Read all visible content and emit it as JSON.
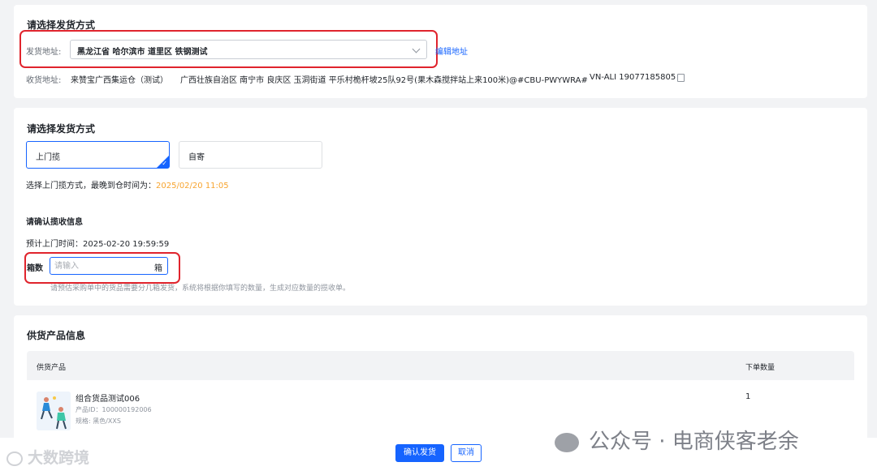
{
  "shipping": {
    "section_title": "请选择发货方式",
    "from_label": "发货地址:",
    "from_value": "黑龙江省 哈尔滨市 道里区 铁钢测试",
    "edit_address": "编辑地址",
    "to_label": "收货地址:",
    "to_value": "来赞宝广西集运仓（测试）",
    "to_address": "广西壮族自治区 南宁市 良庆区 玉洞街道 平乐村桅杆坡25队92号(果木森搅拌站上来100米)@#CBU-PWYWRA#",
    "to_phone": "VN-ALI 19077185805"
  },
  "method": {
    "section_title": "请选择发货方式",
    "options": [
      {
        "label": "上门揽",
        "selected": true
      },
      {
        "label": "自寄",
        "selected": false
      }
    ],
    "note_prefix": "选择上门揽方式，最晚到仓时间为：",
    "deadline": "2025/02/20 11:05",
    "confirm_title": "请确认揽收信息",
    "pickup_time": "预计上门时间：2025-02-20 19:59:59",
    "box_label": "箱数",
    "box_placeholder": "请输入",
    "box_suffix": "箱",
    "box_hint": "请预估采购单中的货品需要分几箱发货，系统将根据你填写的数量，生成对应数量的揽收单。"
  },
  "products": {
    "section_title": "供货产品信息",
    "columns": [
      "供货产品",
      "下单数量"
    ],
    "rows": [
      {
        "name": "组合货品测试006",
        "product_id": "产品ID：100000192006",
        "spec": "规格: 黑色/XXS",
        "qty": "1"
      }
    ]
  },
  "footer": {
    "confirm": "确认发货",
    "cancel": "取消"
  },
  "watermarks": {
    "left": "大数跨境",
    "right": "公众号 · 电商侠客老余"
  },
  "colors": {
    "accent": "#1664ff",
    "deadline": "#f7a42f",
    "highlight_box": "#e0242d"
  }
}
